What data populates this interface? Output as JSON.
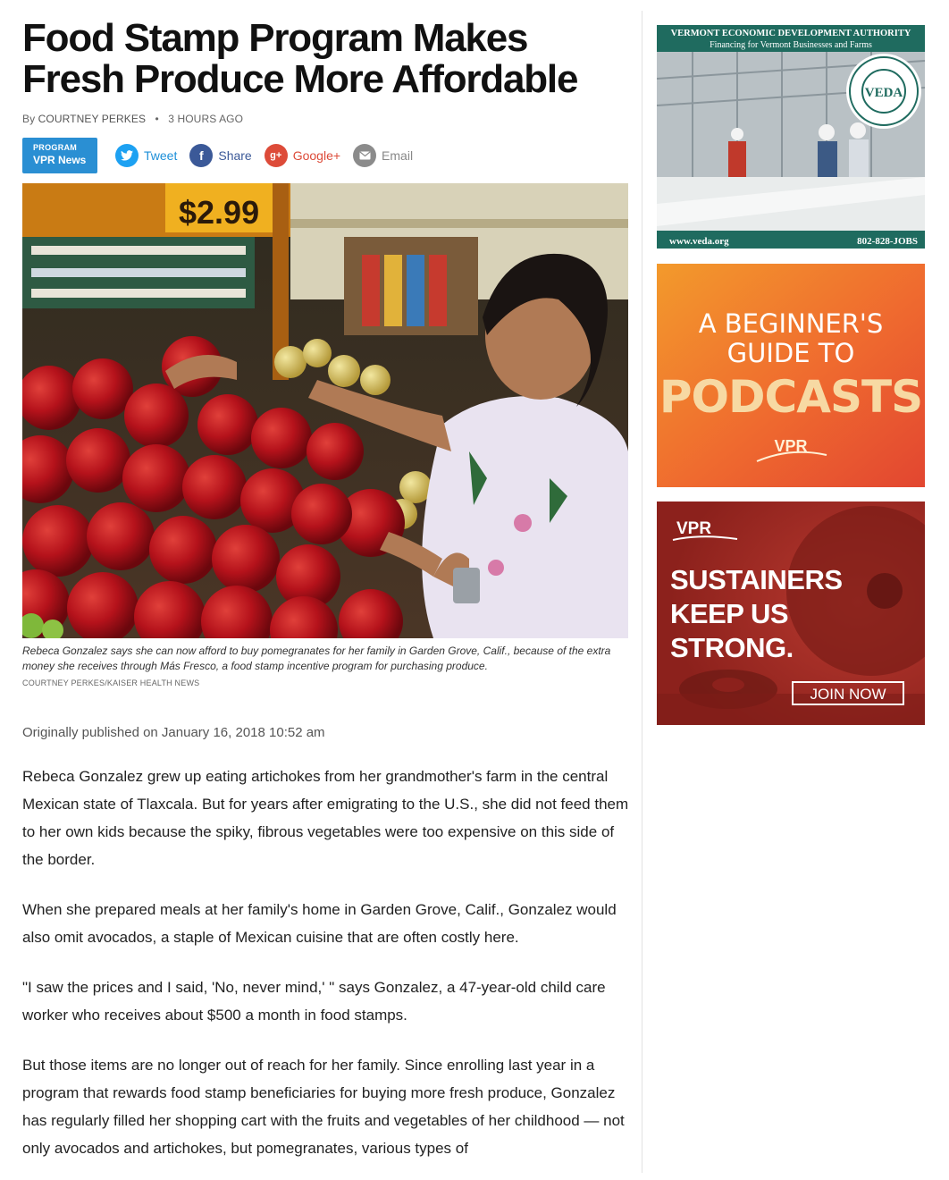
{
  "article": {
    "headline": "Food Stamp Program Makes Fresh Produce More Affordable",
    "byline_prefix": "By",
    "author": "COURTNEY PERKES",
    "time_ago": "3 HOURS AGO",
    "program_label": "PROGRAM",
    "program_name": "VPR News",
    "share": {
      "tweet": "Tweet",
      "facebook": "Share",
      "google": "Google+",
      "email": "Email"
    },
    "photo_price": "$2.99",
    "caption": "Rebeca Gonzalez says she can now afford to buy pomegranates for her family in Garden Grove, Calif., because of the extra money she receives through Más Fresco, a food stamp incentive program for purchasing produce.",
    "credit": "COURTNEY PERKES/KAISER HEALTH NEWS",
    "published": "Originally published on January 16, 2018 10:52 am",
    "paragraphs": [
      "Rebeca Gonzalez grew up eating artichokes from her grandmother's farm in the central Mexican state of Tlaxcala. But for years after emigrating to the U.S., she did not feed them to her own kids because the spiky, fibrous vegetables were too expensive on this side of the border.",
      "When she prepared meals at her family's home in Garden Grove, Calif., Gonzalez would also omit avocados, a staple of Mexican cuisine that are often costly here.",
      "\"I saw the prices and I said, 'No, never mind,' \" says Gonzalez, a 47-year-old child care worker who receives about $500 a month in food stamps.",
      "But those items are no longer out of reach for her family. Since enrolling last year in a program that rewards food stamp beneficiaries for buying more fresh produce, Gonzalez has regularly filled her shopping cart with the fruits and vegetables of her childhood — not only avocados and artichokes, but pomegranates, various types of"
    ]
  },
  "ads": {
    "veda": {
      "title": "VERMONT ECONOMIC DEVELOPMENT AUTHORITY",
      "subtitle": "Financing for Vermont Businesses and Farms",
      "seal_text": "VEDA",
      "seal_ring": "VERMONT ECONOMIC DEVELOPMENT AUTHORITY",
      "url": "www.veda.org",
      "phone": "802-828-JOBS"
    },
    "podcasts": {
      "line1": "A BEGINNER'S",
      "line2": "GUIDE TO",
      "line3": "PODCASTS",
      "brand": "VPR"
    },
    "sustainers": {
      "brand": "VPR",
      "line1": "SUSTAINERS",
      "line2": "KEEP US",
      "line3": "STRONG.",
      "button": "JOIN NOW"
    }
  },
  "colors": {
    "program_badge": "#2a8fd3",
    "twitter": "#1da1f2",
    "facebook": "#3b5998",
    "google": "#dd4b39",
    "email": "#8b8b8b"
  }
}
